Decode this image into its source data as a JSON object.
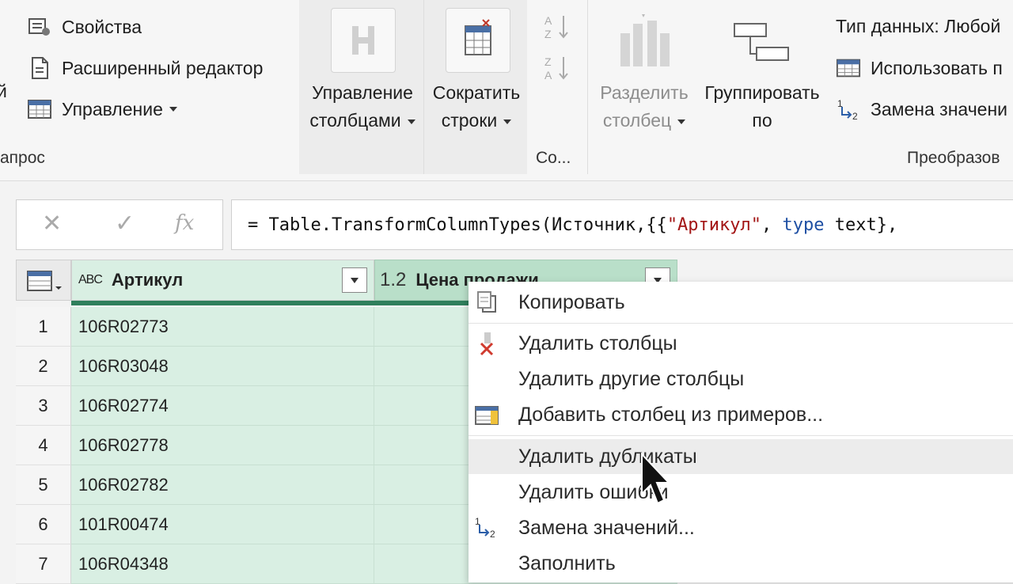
{
  "ribbon": {
    "left_cut_label": "й",
    "group_query_label": "апрос",
    "properties": "Свойства",
    "advanced_editor": "Расширенный редактор",
    "manage": "Управление",
    "manage_columns": [
      "Управление",
      "столбцами"
    ],
    "reduce_rows": [
      "Сократить",
      "строки"
    ],
    "sort_group_label": "Со...",
    "split_column": [
      "Разделить",
      "столбец"
    ],
    "group_by": [
      "Группировать",
      "по"
    ],
    "data_type": "Тип данных: Любой",
    "use_first_row": "Использовать п",
    "replace_values": "Замена значени",
    "transform_group_label": "Преобразов"
  },
  "formula_bar": {
    "fx": "fx",
    "prefix": "= Table.TransformColumnTypes(Источник,{{",
    "str1": "\"Артикул\"",
    "mid": ", ",
    "kw": "type",
    "tail": " text},"
  },
  "grid": {
    "columns": [
      {
        "type_icon": "ABC",
        "name": "Артикул"
      },
      {
        "type_icon": "1.2",
        "name": "Цена продажи"
      }
    ],
    "rows": [
      {
        "n": "1",
        "v": "106R02773"
      },
      {
        "n": "2",
        "v": "106R03048"
      },
      {
        "n": "3",
        "v": "106R02774"
      },
      {
        "n": "4",
        "v": "106R02778"
      },
      {
        "n": "5",
        "v": "106R02782"
      },
      {
        "n": "6",
        "v": "101R00474"
      },
      {
        "n": "7",
        "v": "106R04348"
      }
    ]
  },
  "context_menu": {
    "items": [
      "Копировать",
      "Удалить столбцы",
      "Удалить другие столбцы",
      "Добавить столбец из примеров...",
      "Удалить дубликаты",
      "Удалить ошибки",
      "Замена значений...",
      "Заполнить"
    ]
  },
  "colors": {
    "selected_column": "#d9efe3",
    "active_header": "#b9dfc9",
    "selection_bar": "#2f7f5c"
  }
}
